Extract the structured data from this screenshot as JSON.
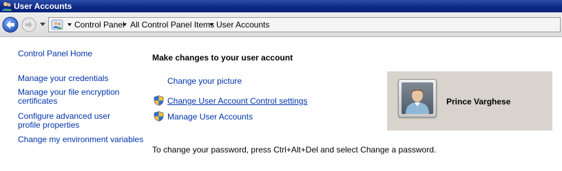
{
  "window": {
    "title": "User Accounts"
  },
  "address_bar": {
    "crumbs": [
      "Control Panel",
      "All Control Panel Items",
      "User Accounts"
    ]
  },
  "sidebar": {
    "home": "Control Panel Home",
    "links": [
      "Manage your credentials",
      "Manage your file encryption certificates",
      "Configure advanced user profile properties",
      "Change my environment variables"
    ]
  },
  "main": {
    "heading": "Make changes to your user account",
    "tasks": [
      {
        "label": "Change your picture",
        "icon": "none"
      },
      {
        "label": "Change User Account Control settings",
        "icon": "uac-shield-icon"
      },
      {
        "label": "Manage User Accounts",
        "icon": "uac-shield-icon"
      }
    ],
    "hint": "To change your password, press Ctrl+Alt+Del and select Change a password."
  },
  "user": {
    "name": "Prince Varghese"
  },
  "colors": {
    "titlebar": "#0d2a86",
    "link": "#0033aa",
    "user_panel": "#d8d4cd"
  }
}
